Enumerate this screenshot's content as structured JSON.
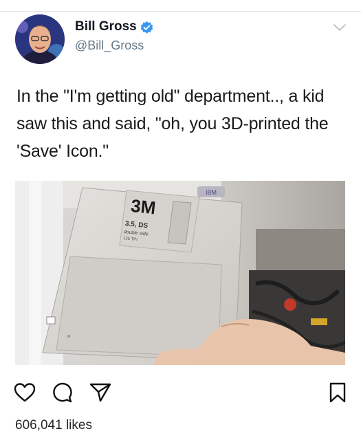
{
  "user": {
    "name": "Bill Gross",
    "handle": "@Bill_Gross"
  },
  "tweet": {
    "text": "In the \"I'm getting old\" department.., a kid saw this and said, \"oh, you 3D-printed the 'Save' Icon.\""
  },
  "photo": {
    "disk_brand": "3M",
    "disk_label_line1": "3.5, DS",
    "disk_label_line2": "double side",
    "disk_label_line3": "135 TPI",
    "monitor_brand": "IBM"
  },
  "stats": {
    "likes": "606,041 likes"
  },
  "icons": {
    "verified": "verified-badge-icon",
    "more": "chevron-down-icon",
    "like": "heart-icon",
    "comment": "comment-icon",
    "share": "send-icon",
    "save": "bookmark-icon"
  },
  "colors": {
    "verified_blue": "#3897f0",
    "handle_gray": "#657786"
  }
}
